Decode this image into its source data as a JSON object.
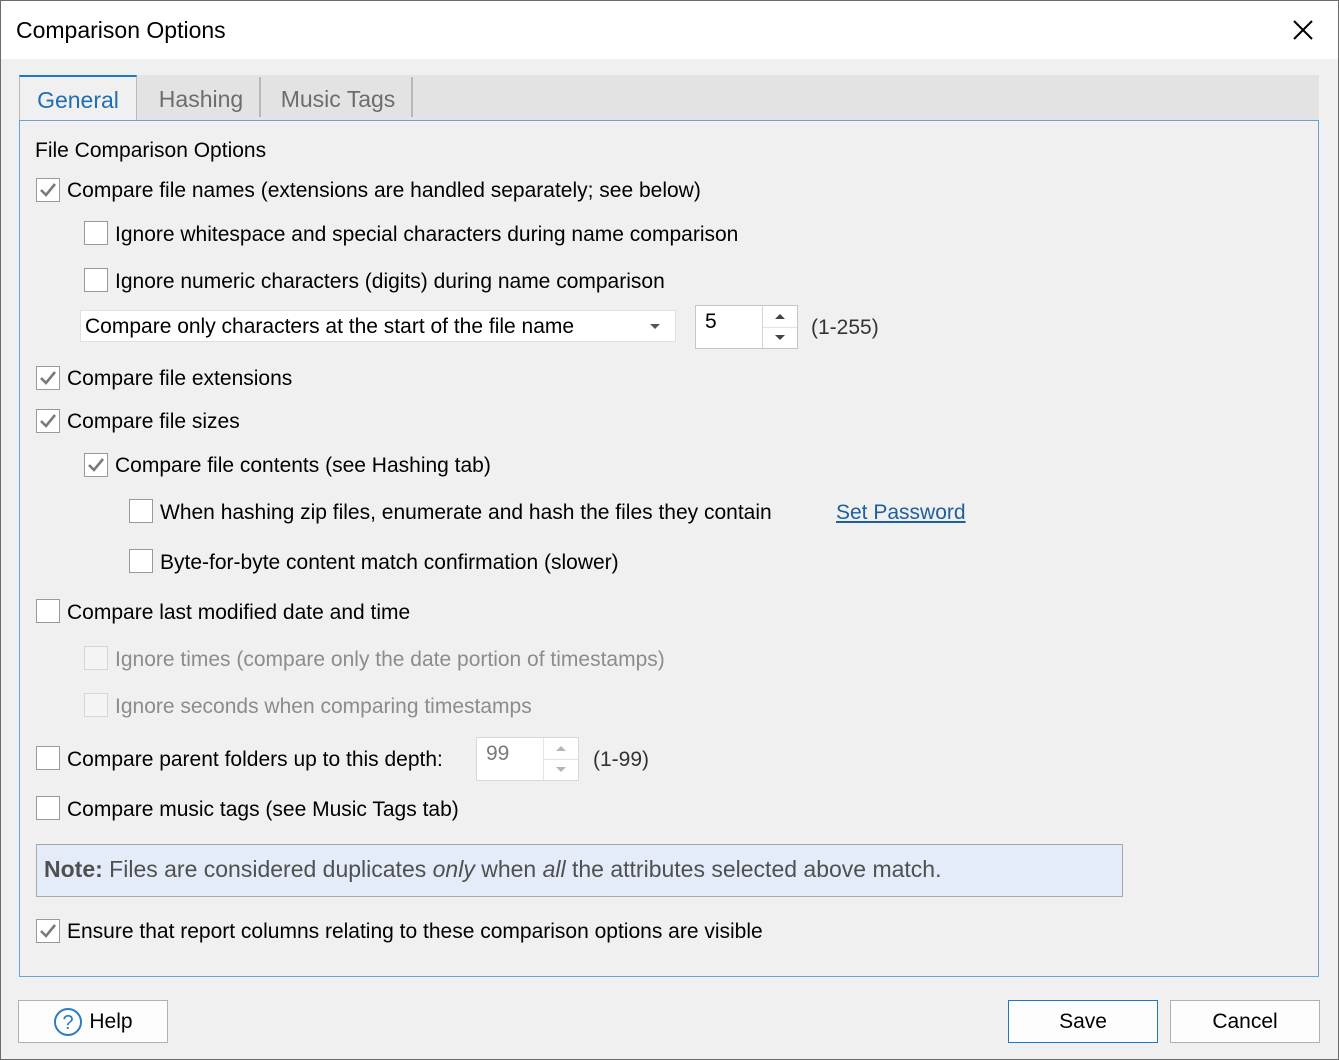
{
  "window": {
    "title": "Comparison Options"
  },
  "tabs": [
    {
      "label": "General",
      "active": true
    },
    {
      "label": "Hashing",
      "active": false
    },
    {
      "label": "Music Tags",
      "active": false
    }
  ],
  "general": {
    "section_title": "File Comparison Options",
    "compare_names": {
      "label": "Compare file names (extensions are handled separately; see below)",
      "checked": true
    },
    "ignore_whitespace": {
      "label": "Ignore whitespace and special characters during name comparison",
      "checked": false
    },
    "ignore_numeric": {
      "label": "Ignore numeric characters (digits) during name comparison",
      "checked": false
    },
    "name_mode": {
      "selected": "Compare only characters at the start of the file name"
    },
    "name_chars": {
      "value": "5",
      "range": "(1-255)"
    },
    "compare_extensions": {
      "label": "Compare file extensions",
      "checked": true
    },
    "compare_sizes": {
      "label": "Compare file sizes",
      "checked": true
    },
    "compare_contents": {
      "label": "Compare file contents (see Hashing tab)",
      "checked": true
    },
    "hash_zip": {
      "label": "When hashing zip files, enumerate and hash the files they contain",
      "checked": false
    },
    "set_password_link": "Set Password",
    "byte_match": {
      "label": "Byte-for-byte content match confirmation (slower)",
      "checked": false
    },
    "compare_modified": {
      "label": "Compare last modified date and time",
      "checked": false
    },
    "ignore_times": {
      "label": "Ignore times (compare only the date portion of timestamps)",
      "checked": false,
      "disabled": true
    },
    "ignore_seconds": {
      "label": "Ignore seconds when comparing timestamps",
      "checked": false,
      "disabled": true
    },
    "compare_folders": {
      "label": "Compare parent folders up to this depth:",
      "checked": false
    },
    "folder_depth": {
      "value": "99",
      "range": "(1-99)",
      "disabled": true
    },
    "compare_music": {
      "label": "Compare music tags (see Music Tags tab)",
      "checked": false
    },
    "note": {
      "bold": "Note:",
      "part1": " Files are considered duplicates ",
      "em1": "only",
      "part2": " when ",
      "em2": "all",
      "part3": " the attributes selected above match."
    },
    "ensure_columns": {
      "label": "Ensure that report columns relating to these comparison options are visible",
      "checked": true
    }
  },
  "footer": {
    "help_label": "Help",
    "save_label": "Save",
    "cancel_label": "Cancel"
  },
  "colors": {
    "accent": "#1e78c8",
    "note_bg": "#e3ecf8",
    "link": "#1e5fa0"
  }
}
